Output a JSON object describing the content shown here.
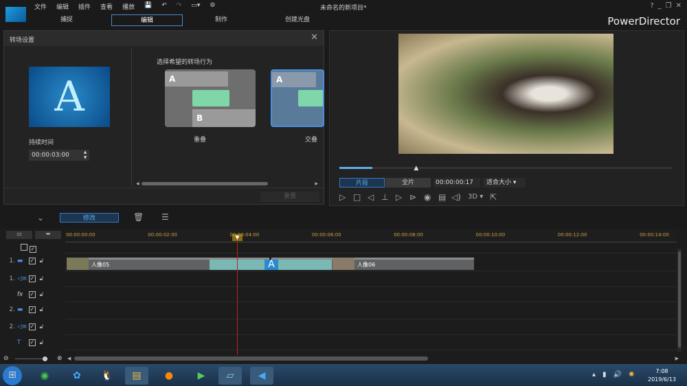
{
  "app": {
    "title": "未命名的新项目*",
    "brand": "PowerDirector",
    "menu": [
      "文件",
      "编辑",
      "插件",
      "查看",
      "播放"
    ],
    "window_buttons": [
      "?",
      "_",
      "❐",
      "✕"
    ]
  },
  "tabs": [
    {
      "label": "捕捉"
    },
    {
      "label": "编辑",
      "active": true
    },
    {
      "label": "制作"
    },
    {
      "label": "创建光盘"
    }
  ],
  "dialog": {
    "title": "转场设置",
    "duration_label": "持续时间",
    "duration_value": "00:00:03:00",
    "behavior_label": "选择希望的转场行为",
    "options": [
      {
        "label": "重叠",
        "a": "A",
        "b": "B"
      },
      {
        "label": "交叠",
        "a": "A",
        "b": "B",
        "selected": true
      }
    ],
    "reset_label": "重置",
    "preview_letter": "A"
  },
  "preview": {
    "segment_tab": "片段",
    "full_tab": "全片",
    "timecode": "00:00:00:17",
    "fit_label": "适合大小",
    "mode_3d": "3D",
    "progress": 0.1
  },
  "toolbar": {
    "modify_label": "修改"
  },
  "timeline": {
    "ticks": [
      "00:00:00:00",
      "00:00:02:00",
      "00:00:04:00",
      "00:00:06:00",
      "00:00:08:00",
      "00:00:10:00",
      "00:00:12:00",
      "00:00:14:00"
    ],
    "tracks": [
      {
        "num": "1.",
        "type": "video"
      },
      {
        "num": "1.",
        "type": "audio"
      },
      {
        "num": "",
        "type": "fx"
      },
      {
        "num": "2.",
        "type": "video"
      },
      {
        "num": "2.",
        "type": "audio"
      },
      {
        "num": "",
        "type": "title"
      }
    ],
    "clips": [
      {
        "name": "人像05"
      },
      {
        "name": "人像06"
      }
    ],
    "transition_letter": "A",
    "playhead_time": "00:00:04:00"
  },
  "taskbar": {
    "time": "7:08",
    "date": "2019/6/13"
  },
  "colors": {
    "accent": "#4a8ac8",
    "transition": "#7ab8b4",
    "playhead": "#c02020"
  }
}
